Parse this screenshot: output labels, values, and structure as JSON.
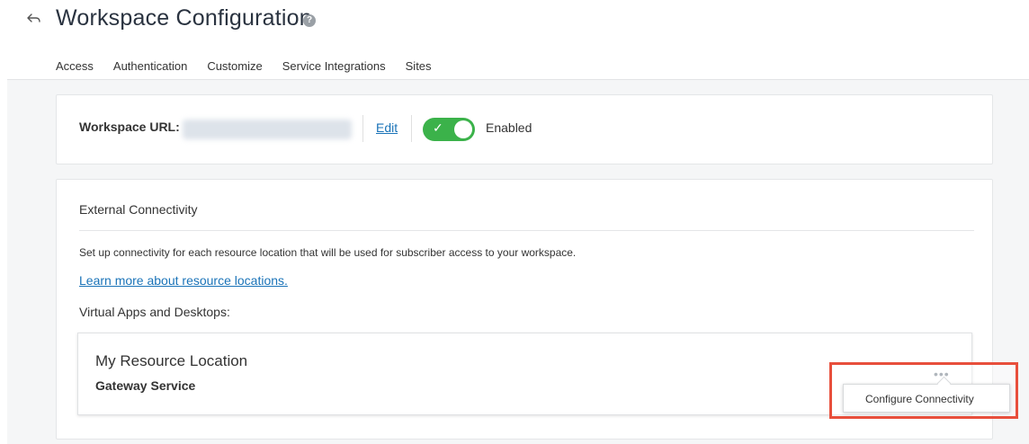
{
  "header": {
    "back_icon": "back-arrow-icon",
    "title": "Workspace Configuration",
    "help_icon": "?"
  },
  "tabs": [
    {
      "label": "Access",
      "active": true
    },
    {
      "label": "Authentication",
      "active": false
    },
    {
      "label": "Customize",
      "active": false
    },
    {
      "label": "Service Integrations",
      "active": false
    },
    {
      "label": "Sites",
      "active": false
    }
  ],
  "workspace_url": {
    "label": "Workspace URL:",
    "edit_label": "Edit",
    "toggle_state": "on",
    "status_label": "Enabled"
  },
  "external_connectivity": {
    "title": "External Connectivity",
    "description": "Set up connectivity for each resource location that will be used for subscriber access to your workspace.",
    "learn_more_link": "Learn more about resource locations.",
    "section_label": "Virtual Apps and Desktops:",
    "resource_location": {
      "name": "My Resource Location",
      "service": "Gateway Service",
      "more_icon": "•••"
    },
    "menu": {
      "items": [
        "Configure Connectivity"
      ]
    }
  },
  "colors": {
    "toggle_on": "#3bb24a",
    "link": "#1a73b8",
    "highlight": "#e84f3c"
  }
}
